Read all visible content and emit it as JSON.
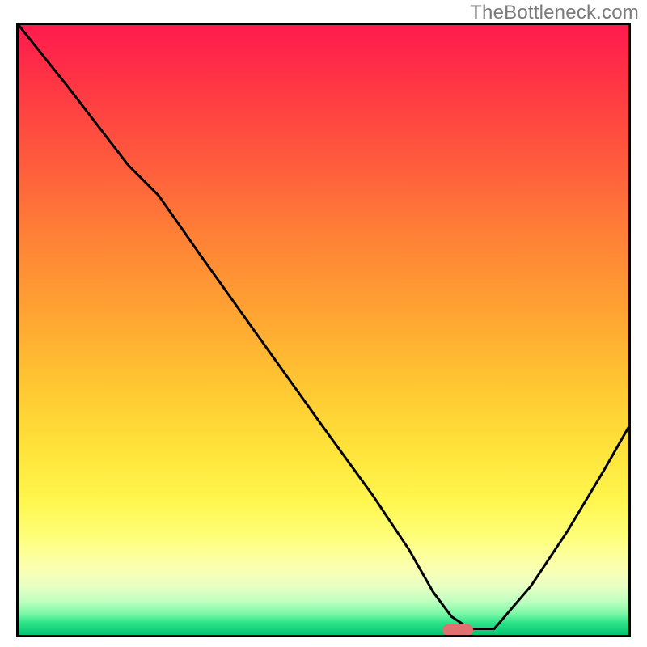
{
  "watermark": "TheBottleneck.com",
  "colors": {
    "border": "#000000",
    "curve": "#000000",
    "marker": "#e17070"
  },
  "chart_data": {
    "type": "line",
    "title": "",
    "xlabel": "",
    "ylabel": "",
    "xlim": [
      0,
      100
    ],
    "ylim": [
      0,
      100
    ],
    "grid": false,
    "legend": false,
    "note": "No axis ticks or numeric labels visible; x/y normalized 0–100. Curve descends from top-left toward a minimum near x≈72 then rises toward right edge.",
    "series": [
      {
        "name": "bottleneck-curve",
        "x": [
          0,
          8,
          18,
          23,
          30,
          40,
          50,
          58,
          64,
          68,
          71,
          74,
          78,
          84,
          90,
          96,
          100
        ],
        "values": [
          100,
          90,
          77,
          72,
          62,
          48,
          34,
          23,
          14,
          7,
          3,
          1,
          1,
          8,
          17,
          27,
          34
        ]
      }
    ],
    "marker": {
      "x": 72,
      "y": 0.8,
      "width": 5,
      "height": 1.8
    }
  }
}
